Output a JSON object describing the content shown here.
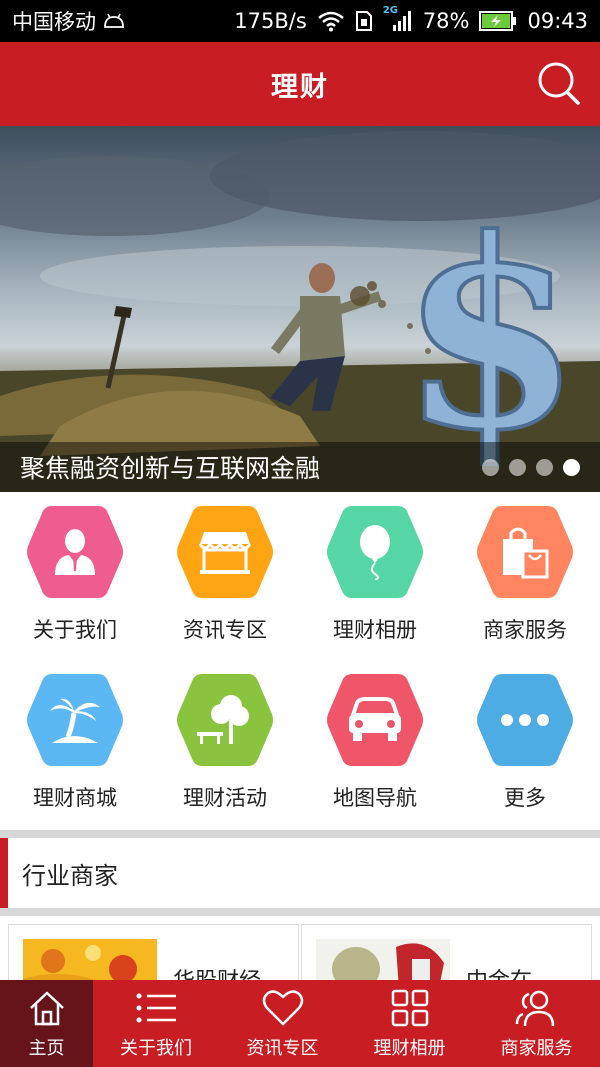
{
  "status_bar": {
    "carrier": "中国移动",
    "net_speed": "175B/s",
    "network_type": "2G",
    "battery": "78%",
    "time": "09:43"
  },
  "header": {
    "title": "理财",
    "search_icon": "search-icon"
  },
  "banner": {
    "caption": "聚焦融资创新与互联网金融",
    "dots_total": 4,
    "active_dot": 4
  },
  "grid": {
    "items": [
      {
        "label": "关于我们",
        "icon": "person-icon",
        "color": "#ef5c8f"
      },
      {
        "label": "资讯专区",
        "icon": "shop-icon",
        "color": "#ffa513"
      },
      {
        "label": "理财相册",
        "icon": "balloon-icon",
        "color": "#56d6a4"
      },
      {
        "label": "商家服务",
        "icon": "shopping-bag-icon",
        "color": "#ff8560"
      },
      {
        "label": "理财商城",
        "icon": "palm-island-icon",
        "color": "#5bb8f5"
      },
      {
        "label": "理财活动",
        "icon": "tree-bench-icon",
        "color": "#8ac33d"
      },
      {
        "label": "地图导航",
        "icon": "car-icon",
        "color": "#f0566a"
      },
      {
        "label": "更多",
        "icon": "more-dots-icon",
        "color": "#4dace4"
      }
    ]
  },
  "section": {
    "title": "行业商家"
  },
  "merchants": [
    {
      "name": "华股财经"
    },
    {
      "name": "中金在..."
    }
  ],
  "tabbar": {
    "items": [
      {
        "label": "主页",
        "icon": "home-icon",
        "active": true
      },
      {
        "label": "关于我们",
        "icon": "list-icon",
        "active": false
      },
      {
        "label": "资讯专区",
        "icon": "heart-icon",
        "active": false
      },
      {
        "label": "理财相册",
        "icon": "grid-icon",
        "active": false
      },
      {
        "label": "商家服务",
        "icon": "users-icon",
        "active": false
      }
    ]
  },
  "colors": {
    "brand_red": "#c81d23",
    "tab_active": "#66141a"
  }
}
